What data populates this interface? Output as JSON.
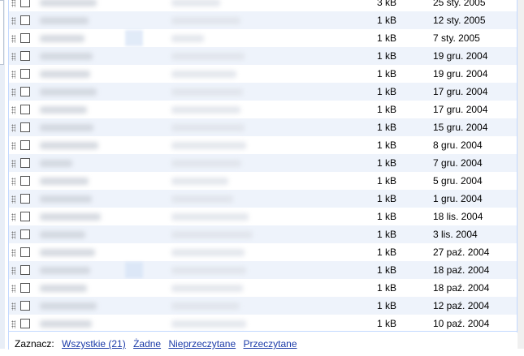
{
  "rows": [
    {
      "size": "3 kB",
      "date": "25 sty. 2005"
    },
    {
      "size": "1 kB",
      "date": "12 sty. 2005"
    },
    {
      "size": "1 kB",
      "date": "7 sty. 2005"
    },
    {
      "size": "1 kB",
      "date": "19 gru. 2004"
    },
    {
      "size": "1 kB",
      "date": "19 gru. 2004"
    },
    {
      "size": "1 kB",
      "date": "17 gru. 2004"
    },
    {
      "size": "1 kB",
      "date": "17 gru. 2004"
    },
    {
      "size": "1 kB",
      "date": "15 gru. 2004"
    },
    {
      "size": "1 kB",
      "date": "8 gru. 2004"
    },
    {
      "size": "1 kB",
      "date": "7 gru. 2004"
    },
    {
      "size": "1 kB",
      "date": "5 gru. 2004"
    },
    {
      "size": "1 kB",
      "date": "1 gru. 2004"
    },
    {
      "size": "1 kB",
      "date": "18 lis. 2004"
    },
    {
      "size": "1 kB",
      "date": "3 lis. 2004"
    },
    {
      "size": "1 kB",
      "date": "27 paź. 2004"
    },
    {
      "size": "1 kB",
      "date": "18 paź. 2004"
    },
    {
      "size": "1 kB",
      "date": "18 paź. 2004"
    },
    {
      "size": "1 kB",
      "date": "12 paź. 2004"
    },
    {
      "size": "1 kB",
      "date": "10 paź. 2004"
    }
  ],
  "footer": {
    "select_label": "Zaznacz:",
    "all": "Wszystkie (21)",
    "none": "Żadne",
    "unread": "Nieprzeczytane",
    "read": "Przeczytane"
  }
}
